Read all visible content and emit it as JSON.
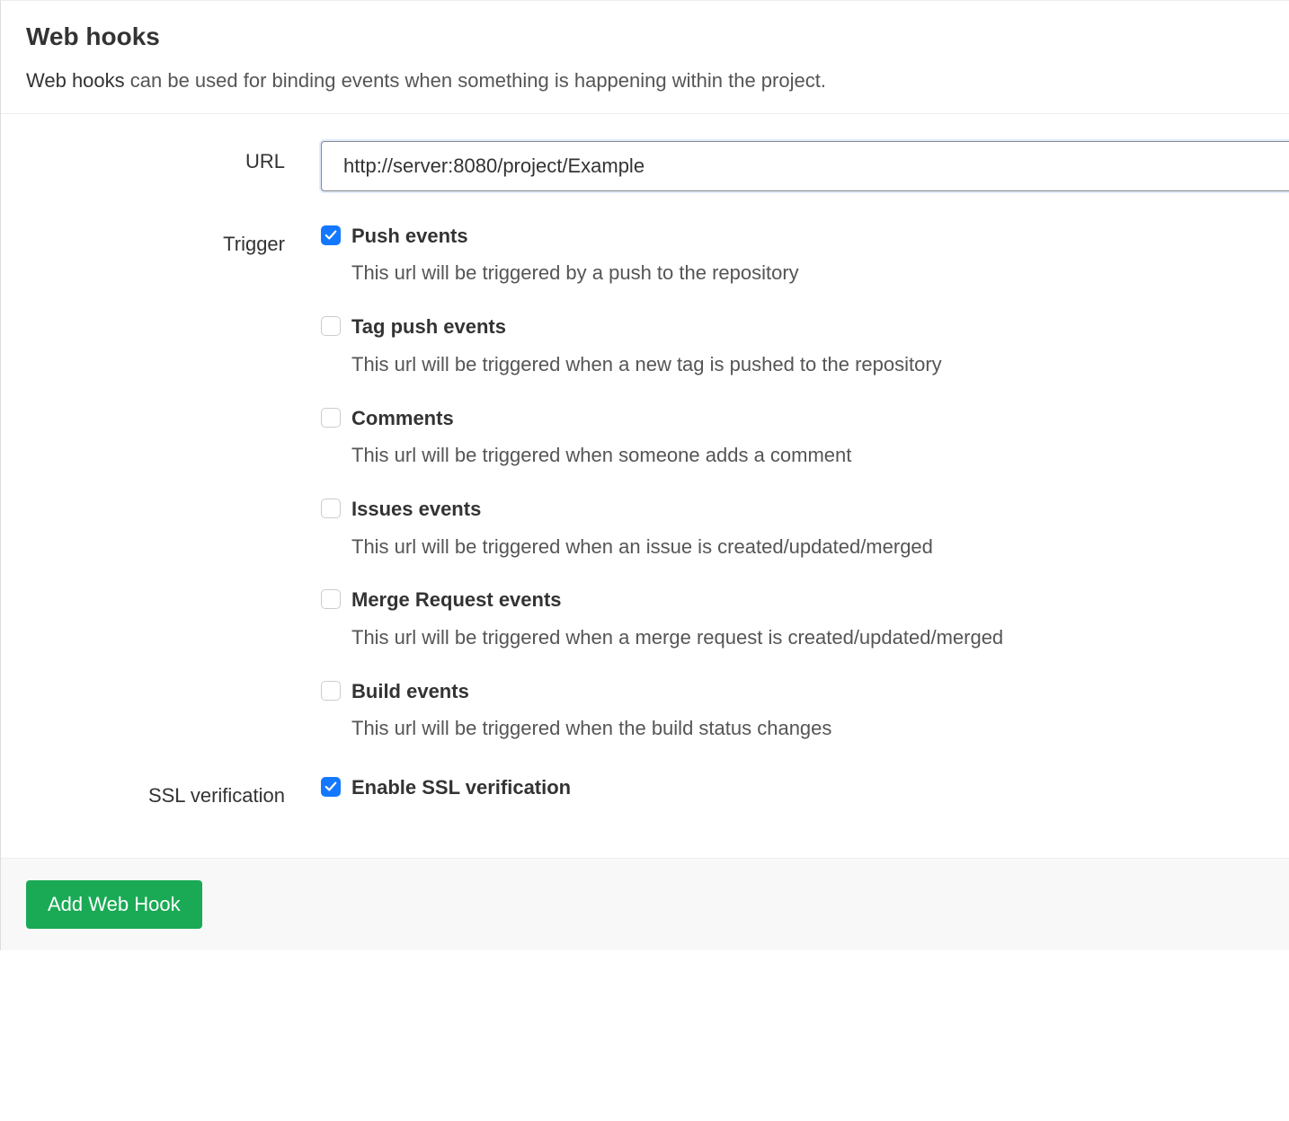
{
  "header": {
    "title": "Web hooks",
    "description_emph": "Web hooks",
    "description_rest": " can be used for binding events when something is happening within the project."
  },
  "form": {
    "url": {
      "label": "URL",
      "value": "http://server:8080/project/Example"
    },
    "trigger": {
      "label": "Trigger",
      "items": [
        {
          "title": "Push events",
          "desc": "This url will be triggered by a push to the repository",
          "checked": true
        },
        {
          "title": "Tag push events",
          "desc": "This url will be triggered when a new tag is pushed to the repository",
          "checked": false
        },
        {
          "title": "Comments",
          "desc": "This url will be triggered when someone adds a comment",
          "checked": false
        },
        {
          "title": "Issues events",
          "desc": "This url will be triggered when an issue is created/updated/merged",
          "checked": false
        },
        {
          "title": "Merge Request events",
          "desc": "This url will be triggered when a merge request is created/updated/merged",
          "checked": false
        },
        {
          "title": "Build events",
          "desc": "This url will be triggered when the build status changes",
          "checked": false
        }
      ]
    },
    "ssl": {
      "label": "SSL verification",
      "option_label": "Enable SSL verification",
      "checked": true
    }
  },
  "footer": {
    "add_button": "Add Web Hook"
  },
  "colors": {
    "accent_blue": "#1378ff",
    "button_green": "#1aaa55"
  }
}
